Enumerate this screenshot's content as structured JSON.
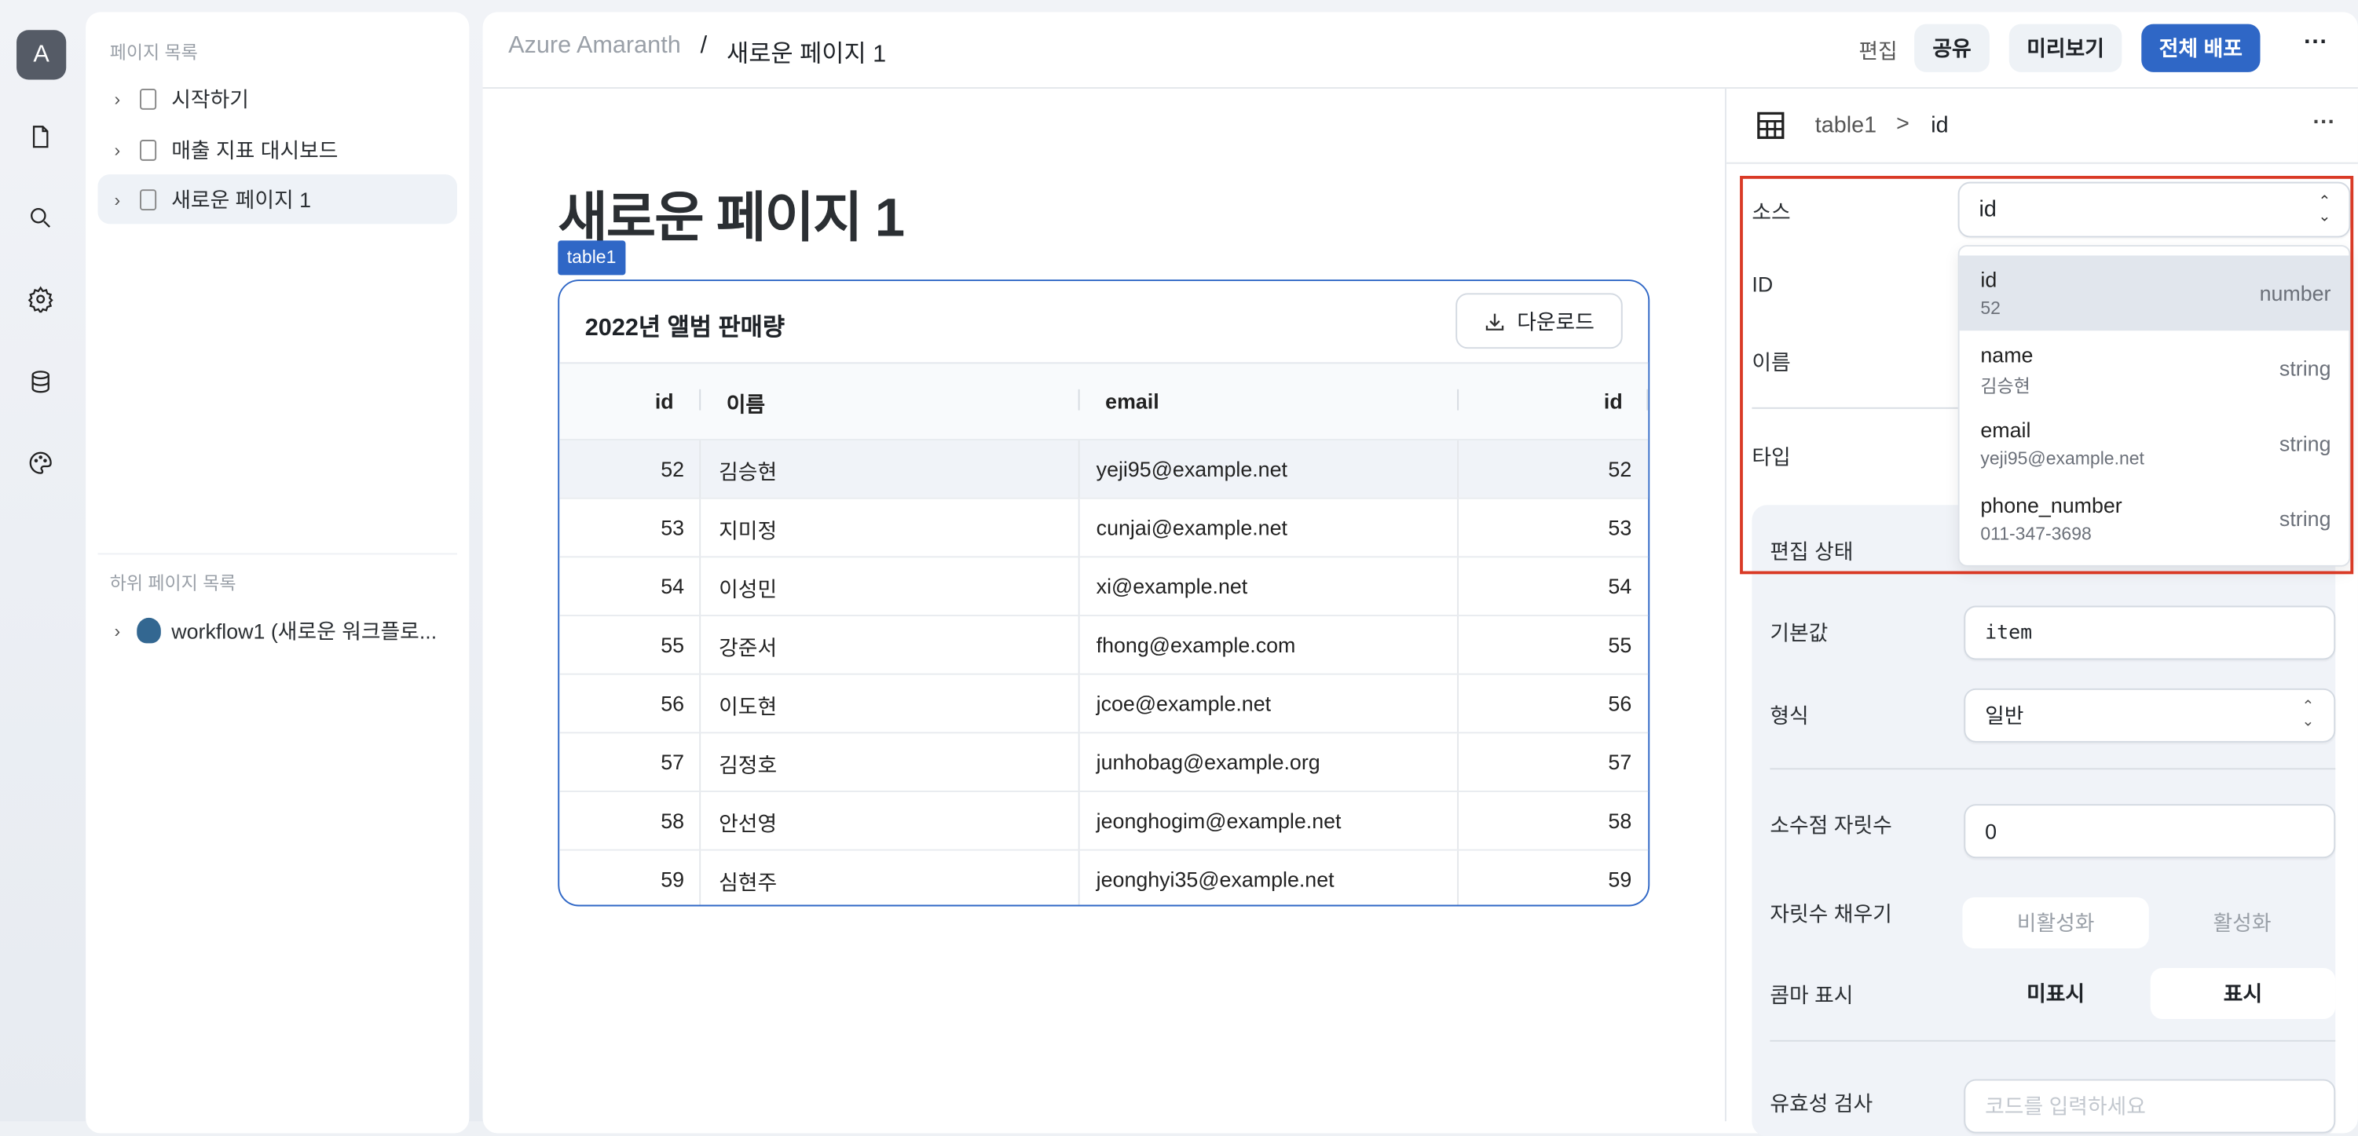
{
  "rail": {
    "avatar": "A",
    "items": [
      "file-icon",
      "search-icon",
      "gear-icon",
      "database-icon",
      "palette-icon"
    ]
  },
  "sidebar": {
    "pages_title": "페이지 목록",
    "pages": [
      {
        "label": "시작하기"
      },
      {
        "label": "매출 지표 대시보드"
      },
      {
        "label": "새로운 페이지 1",
        "selected": true
      }
    ],
    "subpages_title": "하위 페이지 목록",
    "subpages": [
      {
        "label": "workflow1 (새로운 워크플로...",
        "icon": "postgresql-elephant-icon"
      }
    ]
  },
  "header": {
    "breadcrumb": [
      "Azure Amaranth",
      "/",
      "새로운 페이지 1"
    ],
    "edit_label": "편집",
    "share": "공유",
    "preview": "미리보기",
    "deploy": "전체 배포",
    "more": "···"
  },
  "colors": {
    "accent": "#2f67c6",
    "highlight_border": "#d93a26"
  },
  "canvas": {
    "page_title": "새로운 페이지 1",
    "component_tag": "table1",
    "table": {
      "title": "2022년 앨범 판매량",
      "download": "다운로드",
      "columns": [
        "id",
        "이름",
        "email",
        "id"
      ],
      "rows": [
        [
          "52",
          "김승현",
          "yeji95@example.net",
          "52"
        ],
        [
          "53",
          "지미정",
          "cunjai@example.net",
          "53"
        ],
        [
          "54",
          "이성민",
          "xi@example.net",
          "54"
        ],
        [
          "55",
          "강준서",
          "fhong@example.com",
          "55"
        ],
        [
          "56",
          "이도현",
          "jcoe@example.net",
          "56"
        ],
        [
          "57",
          "김정호",
          "junhobag@example.org",
          "57"
        ],
        [
          "58",
          "안선영",
          "jeonghogim@example.net",
          "58"
        ],
        [
          "59",
          "심현주",
          "jeonghyi35@example.net",
          "59"
        ]
      ]
    }
  },
  "inspector": {
    "breadcrumb": {
      "component": "table1",
      "sep": ">",
      "field": "id"
    },
    "more": "···",
    "labels": {
      "source": "소스",
      "id": "ID",
      "name": "이름",
      "type": "타입",
      "edit_state": "편집 상태",
      "default": "기본값",
      "format": "형식",
      "decimals": "소수점 자릿수",
      "pad": "자릿수 채우기",
      "comma": "콤마 표시",
      "validation": "유효성 검사"
    },
    "source_value": "id",
    "dropdown": [
      {
        "key": "id",
        "sample": "52",
        "type": "number",
        "active": true
      },
      {
        "key": "name",
        "sample": "김승현",
        "type": "string"
      },
      {
        "key": "email",
        "sample": "yeji95@example.net",
        "type": "string"
      },
      {
        "key": "phone_number",
        "sample": "011-347-3698",
        "type": "string"
      }
    ],
    "default_value": "item",
    "format_value": "일반",
    "decimals_value": "0",
    "pad_options": [
      "비활성화",
      "활성화"
    ],
    "comma_options": [
      "미표시",
      "표시"
    ],
    "comma_selected": "표시",
    "validation_placeholder": "코드를 입력하세요"
  }
}
